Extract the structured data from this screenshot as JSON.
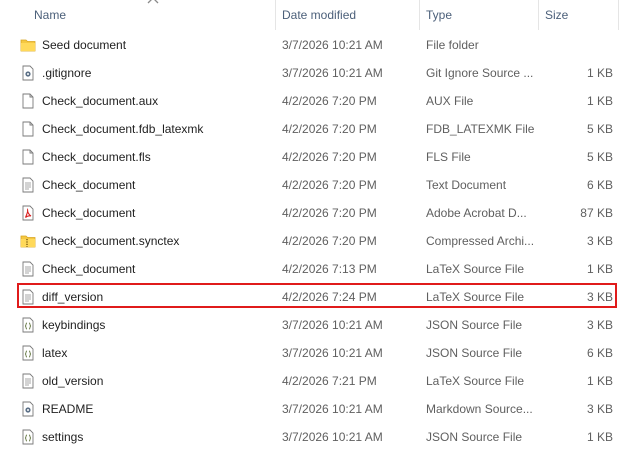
{
  "columns": {
    "name": "Name",
    "date": "Date modified",
    "type": "Type",
    "size": "Size"
  },
  "files": [
    {
      "name": "Seed document",
      "date": "3/7/2026 10:21 AM",
      "type": "File folder",
      "size": "",
      "icon": "folder-icon"
    },
    {
      "name": ".gitignore",
      "date": "3/7/2026 10:21 AM",
      "type": "Git Ignore Source ...",
      "size": "1 KB",
      "icon": "gitignore-file-icon"
    },
    {
      "name": "Check_document.aux",
      "date": "4/2/2026 7:20 PM",
      "type": "AUX File",
      "size": "1 KB",
      "icon": "blank-file-icon"
    },
    {
      "name": "Check_document.fdb_latexmk",
      "date": "4/2/2026 7:20 PM",
      "type": "FDB_LATEXMK File",
      "size": "5 KB",
      "icon": "blank-file-icon"
    },
    {
      "name": "Check_document.fls",
      "date": "4/2/2026 7:20 PM",
      "type": "FLS File",
      "size": "5 KB",
      "icon": "blank-file-icon"
    },
    {
      "name": "Check_document",
      "date": "4/2/2026 7:20 PM",
      "type": "Text Document",
      "size": "6 KB",
      "icon": "text-file-icon"
    },
    {
      "name": "Check_document",
      "date": "4/2/2026 7:20 PM",
      "type": "Adobe Acrobat D...",
      "size": "87 KB",
      "icon": "pdf-file-icon"
    },
    {
      "name": "Check_document.synctex",
      "date": "4/2/2026 7:20 PM",
      "type": "Compressed Archi...",
      "size": "3 KB",
      "icon": "zip-folder-icon"
    },
    {
      "name": "Check_document",
      "date": "4/2/2026 7:13 PM",
      "type": "LaTeX Source File",
      "size": "1 KB",
      "icon": "text-file-icon"
    },
    {
      "name": "diff_version",
      "date": "4/2/2026 7:24 PM",
      "type": "LaTeX Source File",
      "size": "3 KB",
      "icon": "text-file-icon"
    },
    {
      "name": "keybindings",
      "date": "3/7/2026 10:21 AM",
      "type": "JSON Source File",
      "size": "3 KB",
      "icon": "json-file-icon"
    },
    {
      "name": "latex",
      "date": "3/7/2026 10:21 AM",
      "type": "JSON Source File",
      "size": "6 KB",
      "icon": "json-file-icon"
    },
    {
      "name": "old_version",
      "date": "4/2/2026 7:21 PM",
      "type": "LaTeX Source File",
      "size": "1 KB",
      "icon": "text-file-icon"
    },
    {
      "name": "README",
      "date": "3/7/2026 10:21 AM",
      "type": "Markdown Source...",
      "size": "3 KB",
      "icon": "markdown-file-icon"
    },
    {
      "name": "settings",
      "date": "3/7/2026 10:21 AM",
      "type": "JSON Source File",
      "size": "1 KB",
      "icon": "json-file-icon"
    }
  ],
  "colors": {
    "highlight_border": "#e01b1b",
    "header_text": "#4c607a",
    "folder": "#f5c842",
    "pdf": "#d81e1e"
  }
}
